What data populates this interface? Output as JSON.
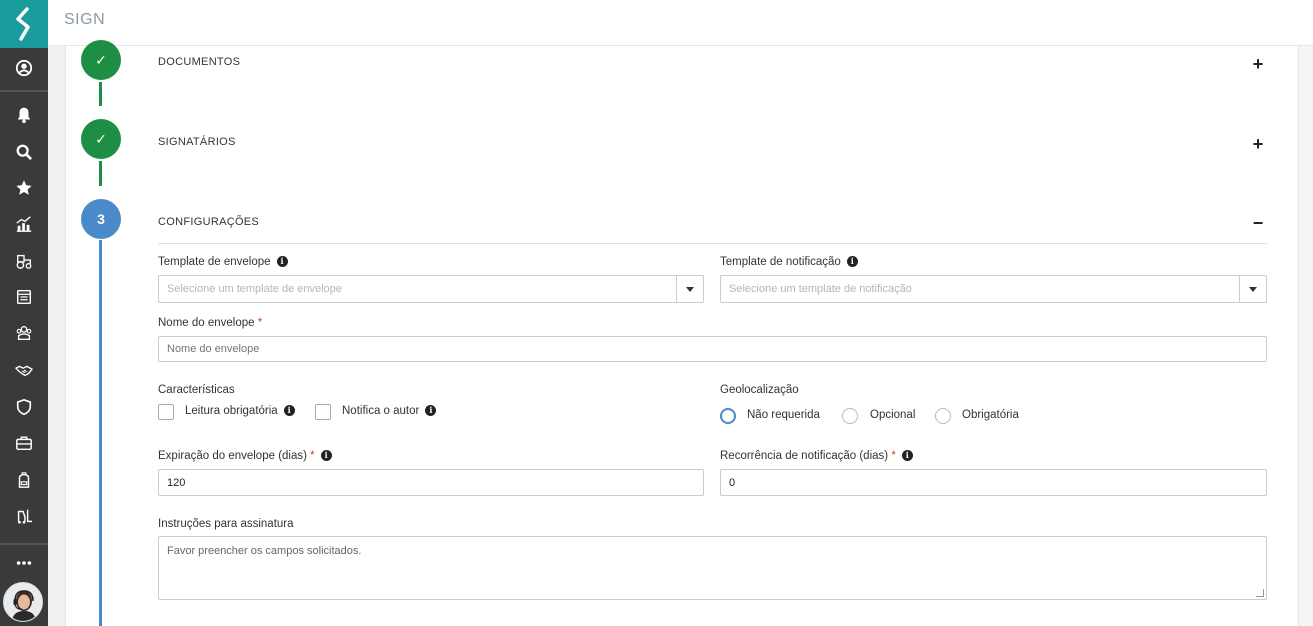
{
  "app": {
    "title": "SIGN"
  },
  "sidebar": {
    "icons": [
      "user-circle-icon",
      "bell-icon",
      "search-icon",
      "star-icon",
      "chart-icon",
      "tractor-icon",
      "document-box-icon",
      "team-icon",
      "handshake-icon",
      "shield-icon",
      "briefcase-icon",
      "backpack-icon",
      "forklift-icon",
      "more-icon"
    ]
  },
  "steps": [
    {
      "number": "✓",
      "title": "DOCUMENTOS",
      "toggle": "+"
    },
    {
      "number": "✓",
      "title": "SIGNATÁRIOS",
      "toggle": "+"
    },
    {
      "number": "3",
      "title": "CONFIGURAÇÕES",
      "toggle": "−"
    }
  ],
  "form": {
    "template_envelope": {
      "label": "Template de envelope",
      "placeholder": "Selecione um template de envelope"
    },
    "template_notificacao": {
      "label": "Template de notificação",
      "placeholder": "Selecione um template de notificação"
    },
    "nome_envelope": {
      "label": "Nome do envelope",
      "required": "*",
      "placeholder": "Nome do envelope"
    },
    "caracteristicas": {
      "label": "Características",
      "options": [
        "Leitura obrigatória",
        "Notifica o autor"
      ]
    },
    "geolocalizacao": {
      "label": "Geolocalização",
      "options": [
        "Não requerida",
        "Opcional",
        "Obrigatória"
      ],
      "selected": "Não requerida"
    },
    "expiracao": {
      "label": "Expiração do envelope (dias)",
      "required": "*",
      "value": "120"
    },
    "recorrencia": {
      "label": "Recorrência de notificação (dias)",
      "required": "*",
      "value": "0"
    },
    "instrucoes": {
      "label": "Instruções para assinatura",
      "value": "Favor preencher os campos solicitados."
    }
  }
}
